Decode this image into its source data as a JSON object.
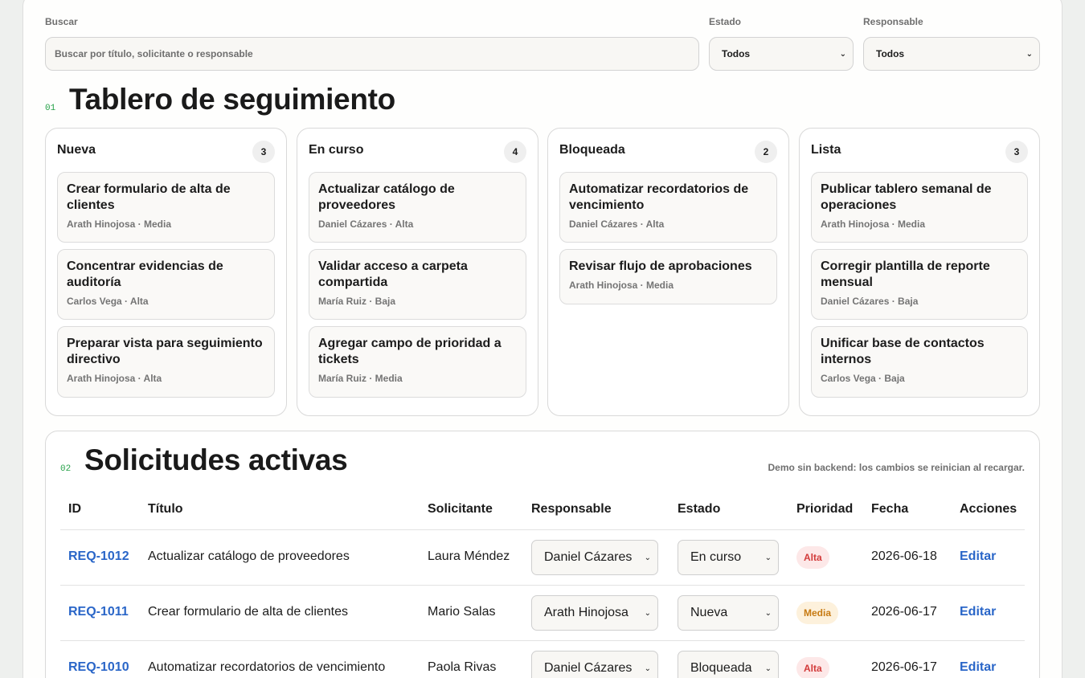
{
  "filters": {
    "search_label": "Buscar",
    "search_placeholder": "Buscar por título, solicitante o responsable",
    "estado_label": "Estado",
    "estado_value": "Todos",
    "responsable_label": "Responsable",
    "responsable_value": "Todos"
  },
  "board": {
    "number": "01",
    "title": "Tablero de seguimiento",
    "columns": [
      {
        "name": "Nueva",
        "count": "3",
        "cards": [
          {
            "title": "Crear formulario de alta de clientes",
            "meta": "Arath Hinojosa · Media"
          },
          {
            "title": "Concentrar evidencias de auditoría",
            "meta": "Carlos Vega · Alta"
          },
          {
            "title": "Preparar vista para seguimiento directivo",
            "meta": "Arath Hinojosa · Alta"
          }
        ]
      },
      {
        "name": "En curso",
        "count": "4",
        "cards": [
          {
            "title": "Actualizar catálogo de proveedores",
            "meta": "Daniel Cázares · Alta"
          },
          {
            "title": "Validar acceso a carpeta compartida",
            "meta": "María Ruiz · Baja"
          },
          {
            "title": "Agregar campo de prioridad a tickets",
            "meta": "María Ruiz · Media"
          }
        ]
      },
      {
        "name": "Bloqueada",
        "count": "2",
        "cards": [
          {
            "title": "Automatizar recordatorios de vencimiento",
            "meta": "Daniel Cázares · Alta"
          },
          {
            "title": "Revisar flujo de aprobaciones",
            "meta": "Arath Hinojosa · Media"
          }
        ]
      },
      {
        "name": "Lista",
        "count": "3",
        "cards": [
          {
            "title": "Publicar tablero semanal de operaciones",
            "meta": "Arath Hinojosa · Media"
          },
          {
            "title": "Corregir plantilla de reporte mensual",
            "meta": "Daniel Cázares · Baja"
          },
          {
            "title": "Unificar base de contactos internos",
            "meta": "Carlos Vega · Baja"
          }
        ]
      }
    ]
  },
  "requests": {
    "number": "02",
    "title": "Solicitudes activas",
    "note": "Demo sin backend: los cambios se reinician al recargar.",
    "headers": [
      "ID",
      "Título",
      "Solicitante",
      "Responsable",
      "Estado",
      "Prioridad",
      "Fecha",
      "Acciones"
    ],
    "rows": [
      {
        "id": "REQ-1012",
        "title": "Actualizar catálogo de proveedores",
        "requester": "Laura Méndez",
        "owner": "Daniel Cázares",
        "status": "En curso",
        "priority": "Alta",
        "date": "2026-06-18",
        "action": "Editar"
      },
      {
        "id": "REQ-1011",
        "title": "Crear formulario de alta de clientes",
        "requester": "Mario Salas",
        "owner": "Arath Hinojosa",
        "status": "Nueva",
        "priority": "Media",
        "date": "2026-06-17",
        "action": "Editar"
      },
      {
        "id": "REQ-1010",
        "title": "Automatizar recordatorios de vencimiento",
        "requester": "Paola Rivas",
        "owner": "Daniel Cázares",
        "status": "Bloqueada",
        "priority": "Alta",
        "date": "2026-06-17",
        "action": "Editar"
      }
    ]
  },
  "colors": {
    "accent_link": "#2a66c8",
    "section_number": "#28a24a",
    "priority_alta_bg": "#fde8e8",
    "priority_alta_text": "#d23a3a",
    "priority_media_bg": "#fdf1dc",
    "priority_media_text": "#c77a12"
  }
}
